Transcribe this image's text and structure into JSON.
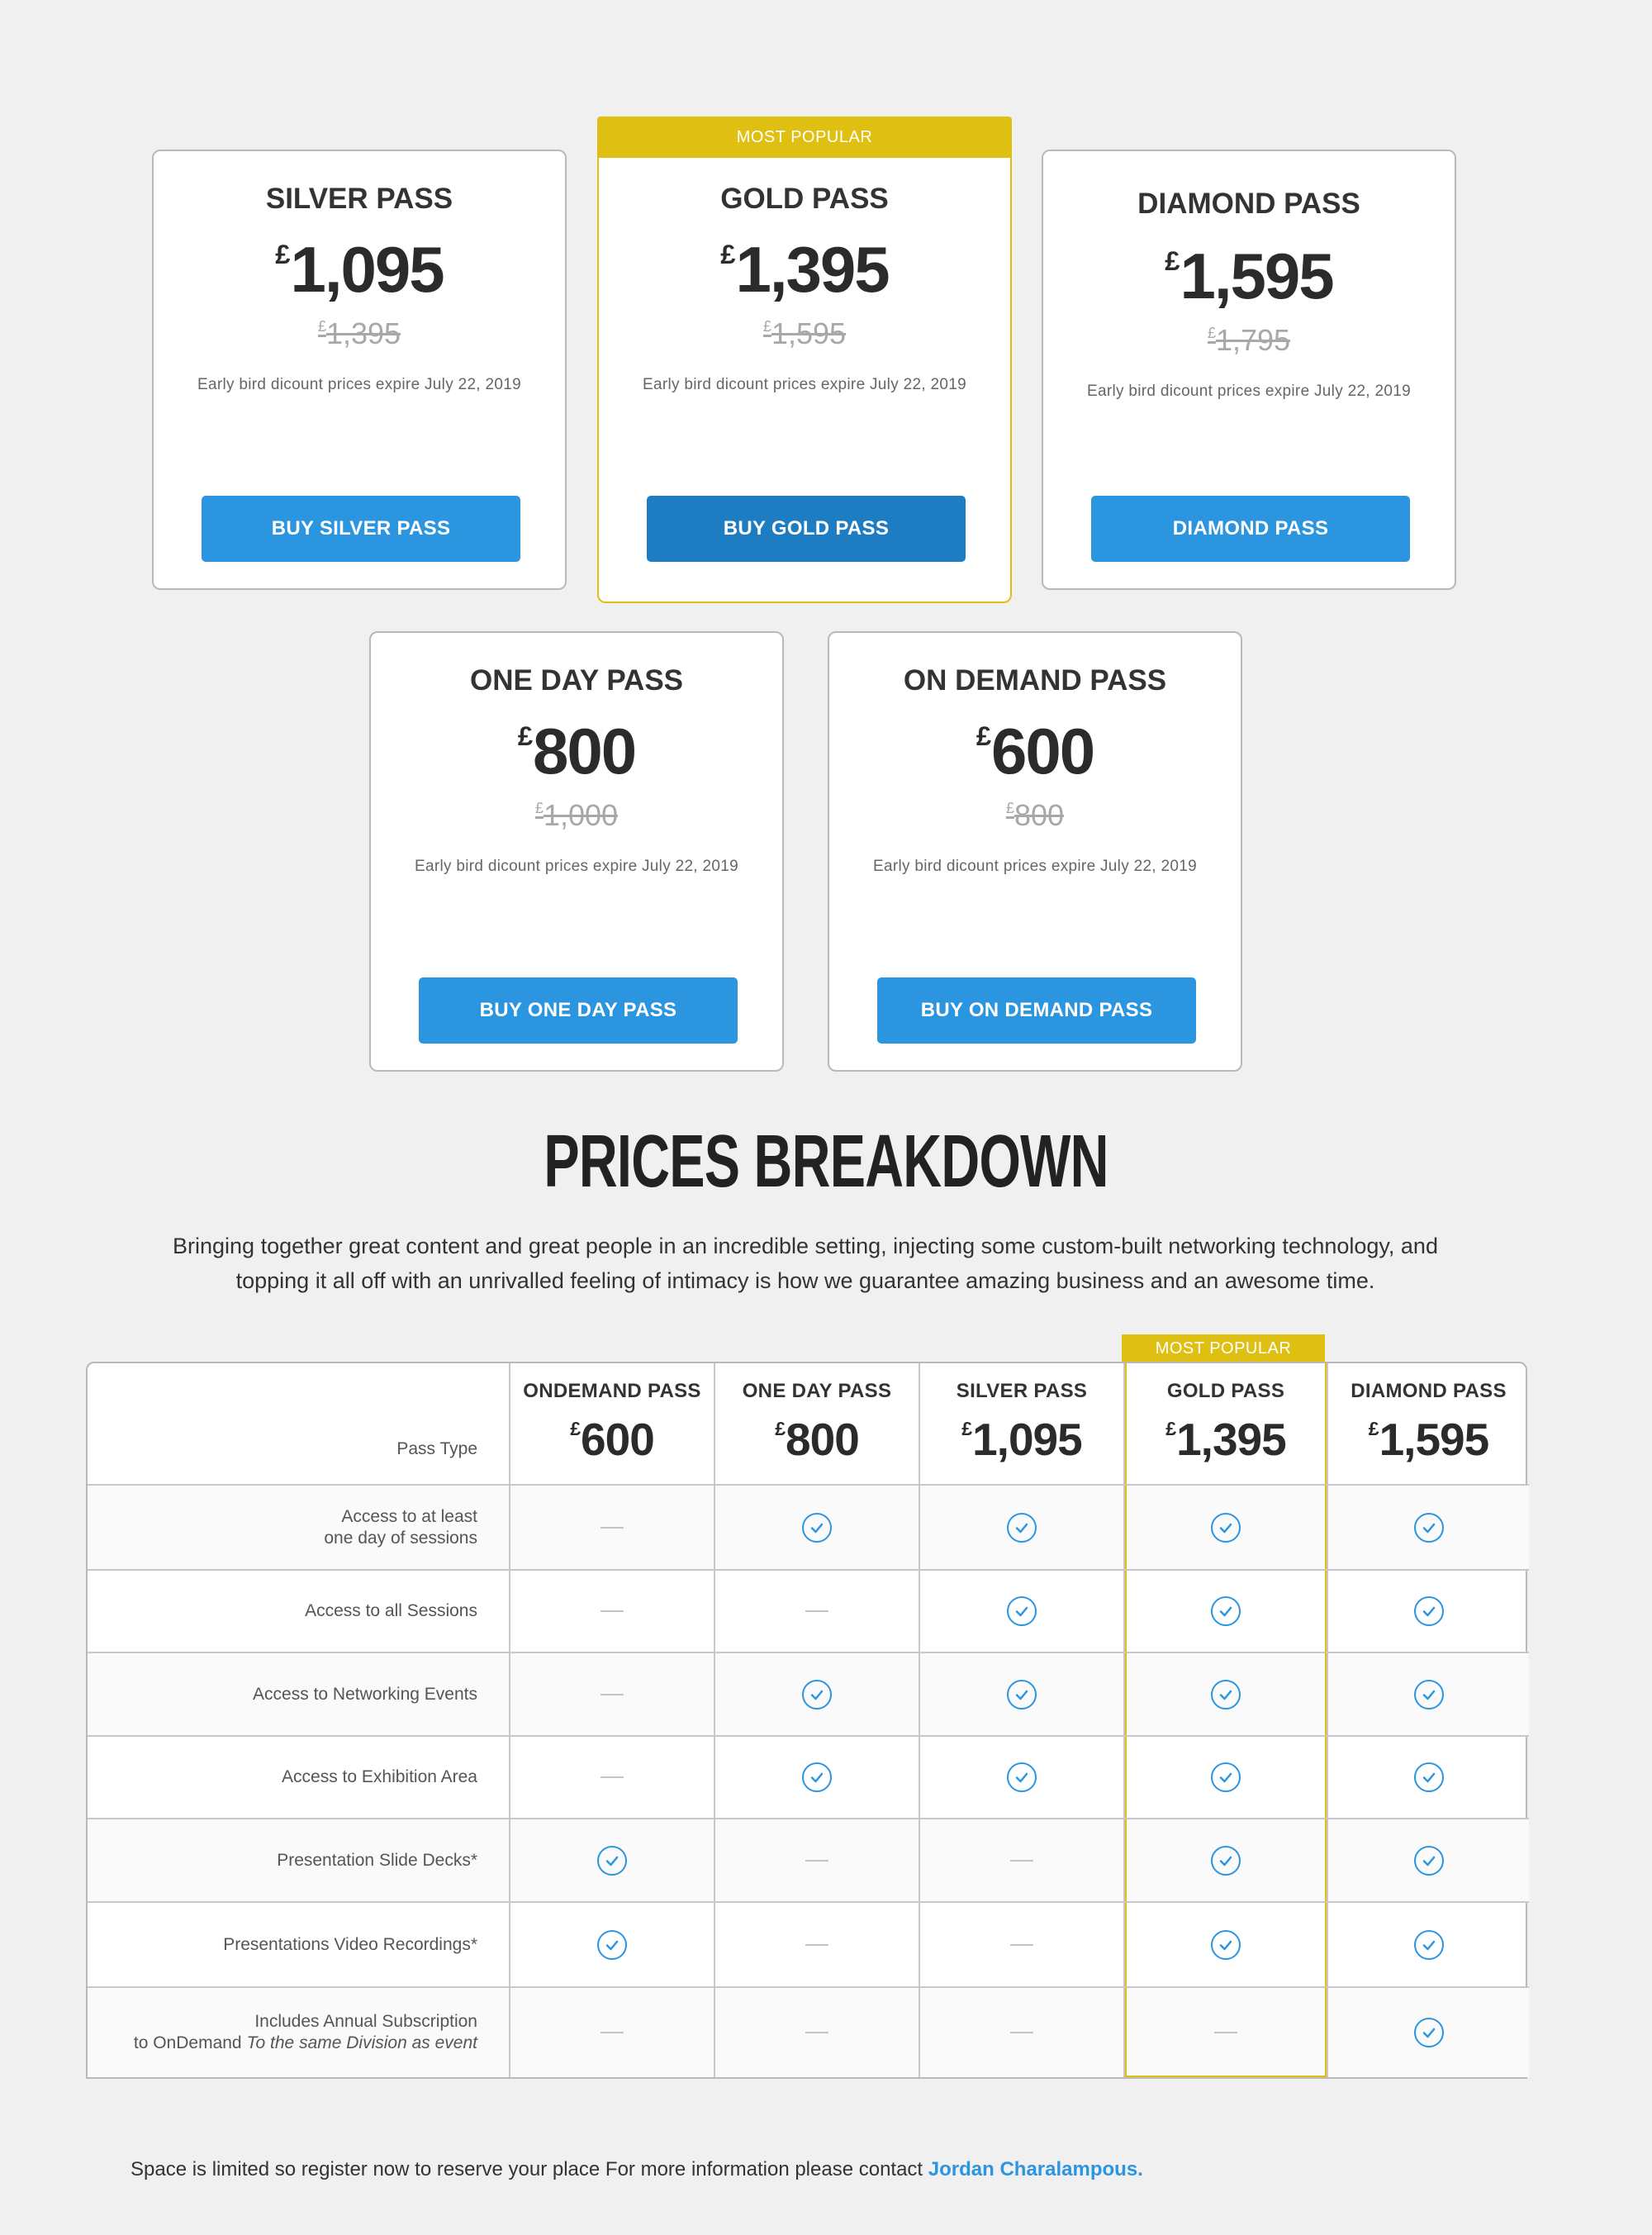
{
  "cards": [
    {
      "title": "SILVER PASS",
      "currency": "£",
      "price": "1,095",
      "old_currency": "£",
      "old_price": "1,395",
      "note": "Early bird dicount prices expire July 22, 2019",
      "button": "BUY SILVER PASS"
    },
    {
      "title": "GOLD PASS",
      "currency": "£",
      "price": "1,395",
      "old_currency": "£",
      "old_price": "1,595",
      "note": "Early bird dicount prices expire July 22, 2019",
      "button": "BUY GOLD PASS",
      "tag": "MOST POPULAR"
    },
    {
      "title": "DIAMOND PASS",
      "currency": "£",
      "price": "1,595",
      "old_currency": "£",
      "old_price": "1,795",
      "note": "Early bird dicount prices expire July 22, 2019",
      "button": "DIAMOND PASS"
    },
    {
      "title": "ONE DAY PASS",
      "currency": "£",
      "price": "800",
      "old_currency": "£",
      "old_price": "1,000",
      "note": "Early bird dicount prices expire July 22, 2019",
      "button": "BUY ONE DAY PASS"
    },
    {
      "title": "ON DEMAND PASS",
      "currency": "£",
      "price": "600",
      "old_currency": "£",
      "old_price": "800",
      "note": "Early bird dicount prices expire July 22, 2019",
      "button": "BUY ON DEMAND PASS"
    }
  ],
  "breakdown": {
    "title": "PRICES BREAKDOWN",
    "intro": "Bringing together great content and great people in an incredible setting, injecting some custom-built networking technology, and topping it all off with an unrivalled feeling of intimacy is how we guarantee amazing business and an awesome time.",
    "popular_tag": "MOST POPULAR",
    "pass_type_label": "Pass Type",
    "columns": [
      {
        "name": "ONDEMAND PASS",
        "currency": "£",
        "price": "600"
      },
      {
        "name": "ONE DAY PASS",
        "currency": "£",
        "price": "800"
      },
      {
        "name": "SILVER PASS",
        "currency": "£",
        "price": "1,095"
      },
      {
        "name": "GOLD PASS",
        "currency": "£",
        "price": "1,395"
      },
      {
        "name": "DIAMOND PASS",
        "currency": "£",
        "price": "1,595"
      }
    ],
    "rows": [
      {
        "label_line1": "Access to at least",
        "label_line2": "one day of sessions",
        "values": [
          false,
          true,
          true,
          true,
          true
        ]
      },
      {
        "label_line1": "Access to all Sessions",
        "label_line2": "",
        "values": [
          false,
          false,
          true,
          true,
          true
        ]
      },
      {
        "label_line1": "Access to Networking Events",
        "label_line2": "",
        "values": [
          false,
          true,
          true,
          true,
          true
        ]
      },
      {
        "label_line1": "Access to Exhibition Area",
        "label_line2": "",
        "values": [
          false,
          true,
          true,
          true,
          true
        ]
      },
      {
        "label_line1": "Presentation Slide Decks*",
        "label_line2": "",
        "values": [
          true,
          false,
          false,
          true,
          true
        ]
      },
      {
        "label_line1": "Presentations Video Recordings*",
        "label_line2": "",
        "values": [
          true,
          false,
          false,
          true,
          true
        ]
      },
      {
        "label_line1": "Includes Annual Subscription",
        "label_line2": "to OnDemand",
        "label_italic": "To the same Division as event",
        "values": [
          false,
          false,
          false,
          false,
          true
        ]
      }
    ]
  },
  "footer": {
    "text": "Space is limited so register now to reserve your place For more information please contact",
    "contact_link": "Jordan Charalampous."
  },
  "colors": {
    "accent": "#2b95e0",
    "popular": "#dfc012",
    "background": "#f0f0f0"
  }
}
